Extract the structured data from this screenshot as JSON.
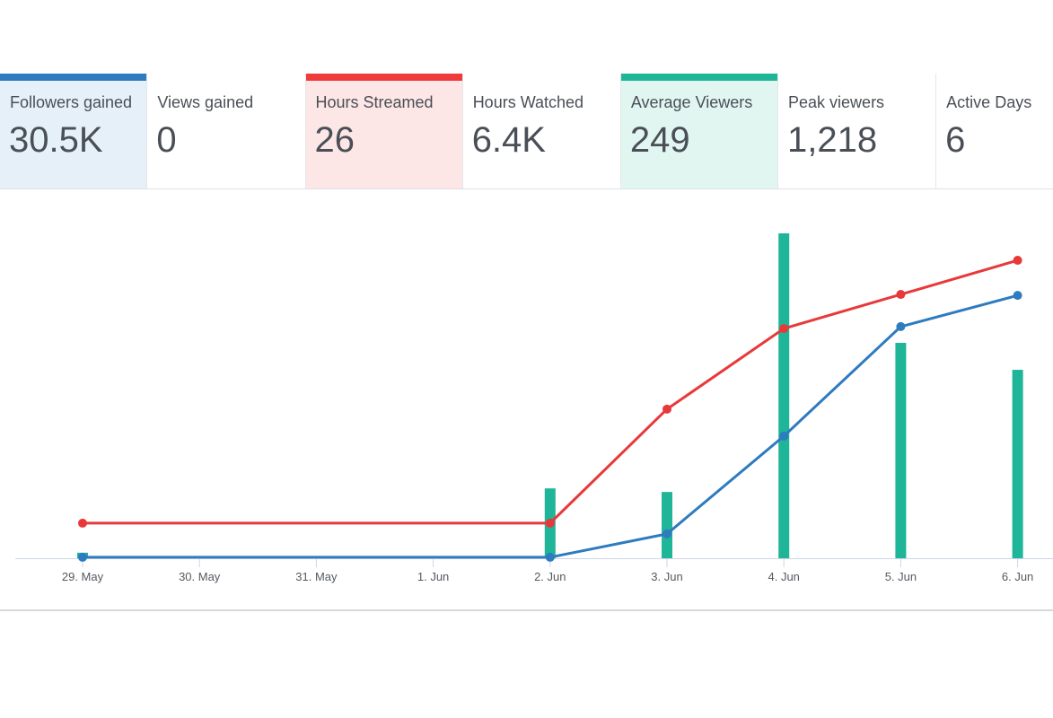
{
  "cards": [
    {
      "label": "Followers gained",
      "value": "30.5K",
      "accent": "#2e7bbf",
      "bg": "#e6f0f8",
      "highlighted": true
    },
    {
      "label": "Views gained",
      "value": "0",
      "accent": null,
      "bg": "#ffffff",
      "highlighted": false
    },
    {
      "label": "Hours Streamed",
      "value": "26",
      "accent": "#ef3b3b",
      "bg": "#fde6e6",
      "highlighted": true
    },
    {
      "label": "Hours Watched",
      "value": "6.4K",
      "accent": null,
      "bg": "#ffffff",
      "highlighted": false
    },
    {
      "label": "Average Viewers",
      "value": "249",
      "accent": "#1fb598",
      "bg": "#e2f6f1",
      "highlighted": true
    },
    {
      "label": "Peak viewers",
      "value": "1,218",
      "accent": null,
      "bg": "#ffffff",
      "highlighted": false
    },
    {
      "label": "Active Days",
      "value": "6",
      "accent": null,
      "bg": "#ffffff",
      "highlighted": false
    }
  ],
  "chart_data": {
    "type": "line",
    "title": "",
    "xlabel": "",
    "ylabel": "",
    "categories": [
      "29. May",
      "30. May",
      "31. May",
      "1. Jun",
      "2. Jun",
      "3. Jun",
      "4. Jun",
      "5. Jun",
      "6. Jun"
    ],
    "y_units": "relative (no y-axis shown; 0-100 of plot height)",
    "ylim": [
      0,
      100
    ],
    "grid": false,
    "legend": "none",
    "series": [
      {
        "name": "Average Viewers",
        "kind": "bar",
        "color": "#1fb598",
        "values": [
          1.7,
          null,
          null,
          null,
          21.5,
          20.4,
          100,
          66.3,
          58
        ]
      },
      {
        "name": "Hours Streamed",
        "kind": "line",
        "color": "#e8393a",
        "values": [
          10.8,
          null,
          null,
          null,
          10.8,
          45.9,
          70.7,
          81.2,
          91.7
        ]
      },
      {
        "name": "Followers gained",
        "kind": "line",
        "color": "#2e7bbf",
        "values": [
          0.3,
          null,
          null,
          null,
          0.3,
          7.5,
          37.6,
          71.3,
          80.9
        ]
      }
    ]
  }
}
